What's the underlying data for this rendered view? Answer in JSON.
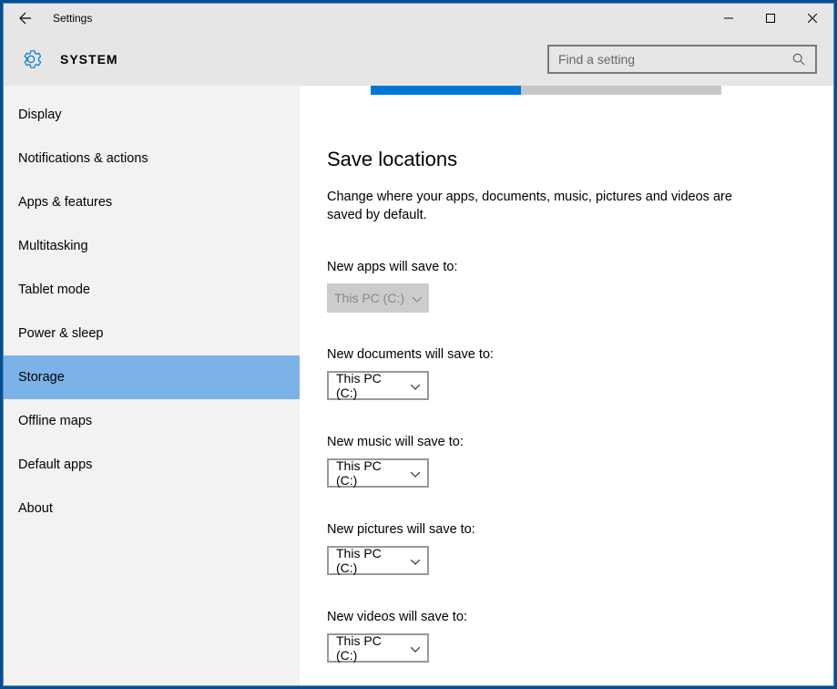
{
  "titlebar": {
    "title": "Settings"
  },
  "header": {
    "label": "SYSTEM",
    "search_placeholder": "Find a setting"
  },
  "sidebar": {
    "items": [
      {
        "label": "Display",
        "active": false
      },
      {
        "label": "Notifications & actions",
        "active": false
      },
      {
        "label": "Apps & features",
        "active": false
      },
      {
        "label": "Multitasking",
        "active": false
      },
      {
        "label": "Tablet mode",
        "active": false
      },
      {
        "label": "Power & sleep",
        "active": false
      },
      {
        "label": "Storage",
        "active": true
      },
      {
        "label": "Offline maps",
        "active": false
      },
      {
        "label": "Default apps",
        "active": false
      },
      {
        "label": "About",
        "active": false
      }
    ]
  },
  "main": {
    "heading": "Save locations",
    "description": "Change where your apps, documents, music, pictures and videos are saved by default.",
    "fields": [
      {
        "label": "New apps will save to:",
        "value": "This PC (C:)",
        "disabled": true
      },
      {
        "label": "New documents will save to:",
        "value": "This PC (C:)",
        "disabled": false
      },
      {
        "label": "New music will save to:",
        "value": "This PC (C:)",
        "disabled": false
      },
      {
        "label": "New pictures will save to:",
        "value": "This PC (C:)",
        "disabled": false
      },
      {
        "label": "New videos will save to:",
        "value": "This PC (C:)",
        "disabled": false
      }
    ]
  }
}
